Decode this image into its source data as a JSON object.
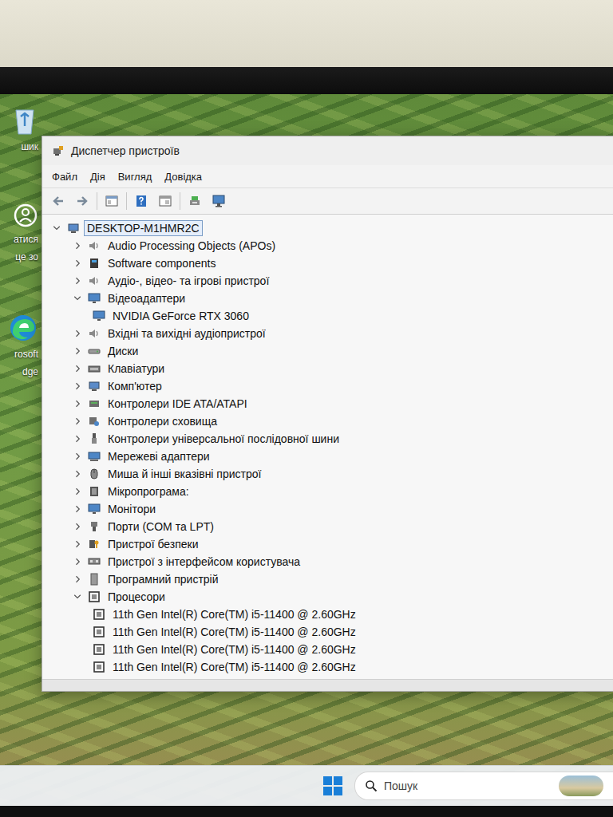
{
  "window": {
    "title": "Диспетчер пристроїв"
  },
  "menu": [
    "Файл",
    "Дія",
    "Вигляд",
    "Довідка"
  ],
  "tree": {
    "label": "DESKTOP-M1HMR2C",
    "expanded": true,
    "selected": true,
    "children": [
      {
        "label": "Audio Processing Objects (APOs)",
        "expanded": false,
        "selected": false,
        "children": []
      },
      {
        "label": "Software components",
        "expanded": false,
        "selected": false,
        "children": []
      },
      {
        "label": "Аудіо-, відео- та ігрові пристрої",
        "expanded": false,
        "selected": false,
        "children": []
      },
      {
        "label": "Відеоадаптери",
        "expanded": true,
        "selected": false,
        "children": [
          {
            "label": "NVIDIA GeForce RTX 3060",
            "selected": false,
            "children": []
          }
        ]
      },
      {
        "label": "Вхідні та вихідні аудіопристрої",
        "expanded": false,
        "selected": false,
        "children": []
      },
      {
        "label": "Диски",
        "expanded": false,
        "selected": false,
        "children": []
      },
      {
        "label": "Клавіатури",
        "expanded": false,
        "selected": false,
        "children": []
      },
      {
        "label": "Комп'ютер",
        "expanded": false,
        "selected": false,
        "children": []
      },
      {
        "label": "Контролери IDE ATA/ATAPI",
        "expanded": false,
        "selected": false,
        "children": []
      },
      {
        "label": "Контролери сховища",
        "expanded": false,
        "selected": false,
        "children": []
      },
      {
        "label": "Контролери універсальної послідовної шини",
        "expanded": false,
        "selected": false,
        "children": []
      },
      {
        "label": "Мережеві адаптери",
        "expanded": false,
        "selected": false,
        "children": []
      },
      {
        "label": "Миша й інші вказівні пристрої",
        "expanded": false,
        "selected": false,
        "children": []
      },
      {
        "label": "Мікропрограма:",
        "expanded": false,
        "selected": false,
        "children": []
      },
      {
        "label": "Монітори",
        "expanded": false,
        "selected": false,
        "children": []
      },
      {
        "label": "Порти (COM та LPT)",
        "expanded": false,
        "selected": false,
        "children": []
      },
      {
        "label": "Пристрої безпеки",
        "expanded": false,
        "selected": false,
        "children": []
      },
      {
        "label": "Пристрої з інтерфейсом користувача",
        "expanded": false,
        "selected": false,
        "children": []
      },
      {
        "label": "Програмний пристрій",
        "expanded": false,
        "selected": false,
        "children": []
      },
      {
        "label": "Процесори",
        "expanded": true,
        "selected": false,
        "children": [
          {
            "label": "11th Gen Intel(R) Core(TM) i5-11400 @ 2.60GHz",
            "selected": false,
            "children": []
          },
          {
            "label": "11th Gen Intel(R) Core(TM) i5-11400 @ 2.60GHz",
            "selected": false,
            "children": []
          },
          {
            "label": "11th Gen Intel(R) Core(TM) i5-11400 @ 2.60GHz",
            "selected": false,
            "children": []
          },
          {
            "label": "11th Gen Intel(R) Core(TM) i5-11400 @ 2.60GHz",
            "selected": false,
            "children": []
          }
        ]
      }
    ]
  },
  "desktop_icons": [
    {
      "lines": [
        "шик"
      ]
    },
    {
      "lines": [
        "атися",
        "це зо"
      ]
    },
    {
      "lines": [
        "rosoft",
        "dge"
      ]
    }
  ],
  "taskbar": {
    "search": {
      "placeholder": "Пошук"
    }
  }
}
